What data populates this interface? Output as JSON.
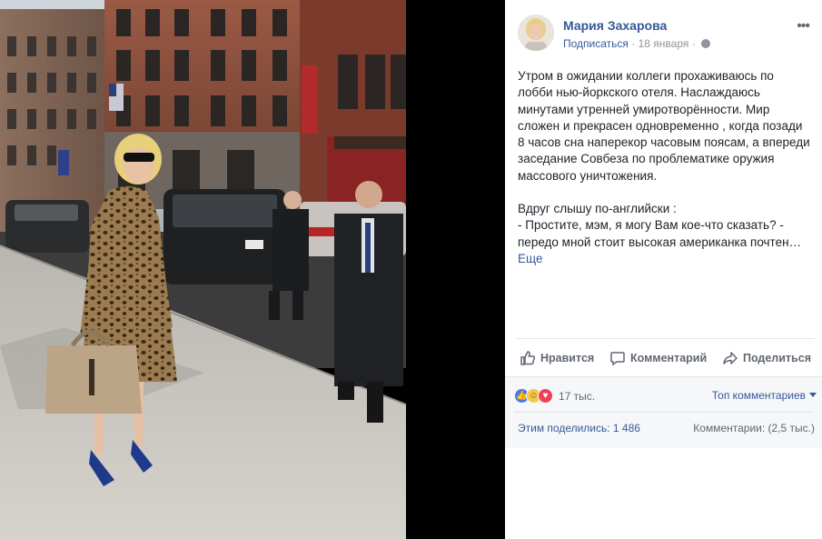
{
  "post": {
    "author": "Мария Захарова",
    "follow_label": "Подписаться",
    "separator": "·",
    "date": "18 января",
    "text_paragraph_1": "Утром в ожидании коллеги прохаживаюсь по лобби нью-йоркского отеля. Наслаждаюсь минутами утренней умиротворённости. Мир сложен и прекрасен одновременно , когда позади 8 часов сна наперекор часовым поясам, а впереди заседание Совбеза по проблематике оружия массового уничтожения.",
    "text_paragraph_2": "Вдруг слышу по-английски :",
    "text_paragraph_3": "- Простите, мэм, я могу Вам кое-что сказать? - передо мной стоит высокая американка почтен…",
    "see_more": "Еще"
  },
  "actions": {
    "like": "Нравится",
    "comment": "Комментарий",
    "share": "Поделиться"
  },
  "stats": {
    "reactions_count": "17 тыс.",
    "top_comments": "Топ комментариев",
    "shares": "Этим поделились: 1 486",
    "comments": "Комментарии: (2,5 тыс.)"
  },
  "icons": {
    "more": "more-options-icon",
    "privacy": "globe-icon",
    "like": "thumbs-up-icon",
    "comment": "comment-bubble-icon",
    "share": "share-arrow-icon"
  },
  "colors": {
    "link": "#365899",
    "secondary_text": "#90949c",
    "action_text": "#606770",
    "stats_bg": "#f6f7f9"
  }
}
